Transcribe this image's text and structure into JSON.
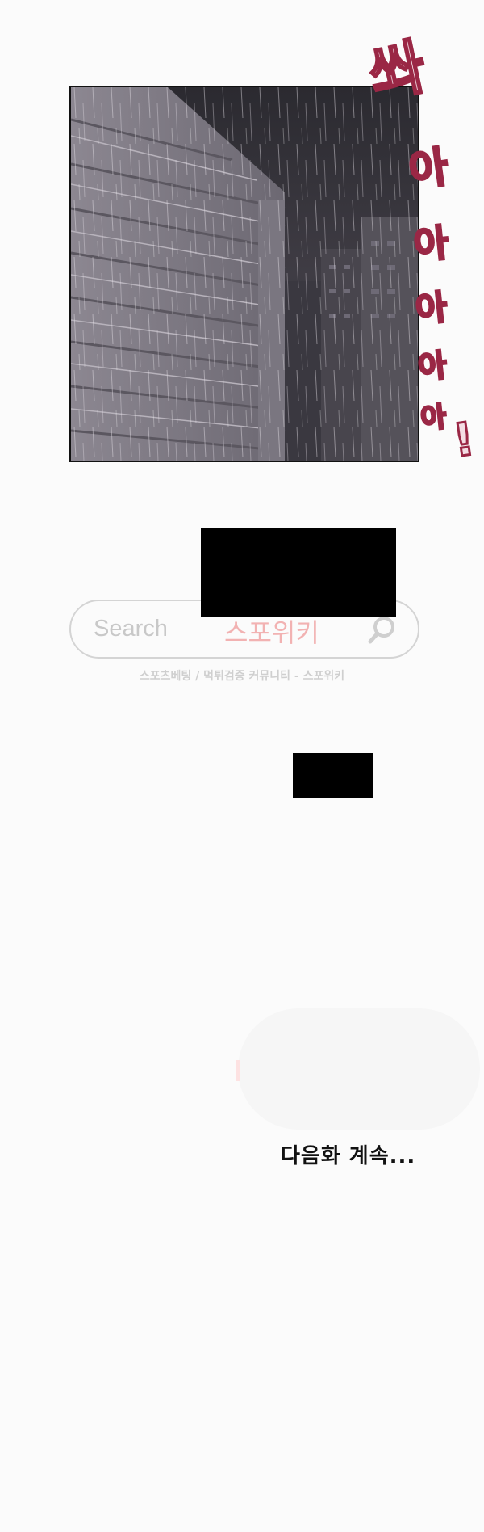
{
  "comic": {
    "sound_effect": "쏴아아아아아!",
    "search_bar": {
      "placeholder": "Search",
      "brand_text": "스포위키",
      "icon": "search-icon"
    },
    "subtitle": "스포츠베팅 / 먹튀검증 커뮤니티 - 스포위키",
    "next_episode_text": "다음화 계속...",
    "colors": {
      "sound_effect": "#f4dde4",
      "sound_effect_outline": "#9a2745",
      "brand": "#f2b2b2"
    }
  }
}
